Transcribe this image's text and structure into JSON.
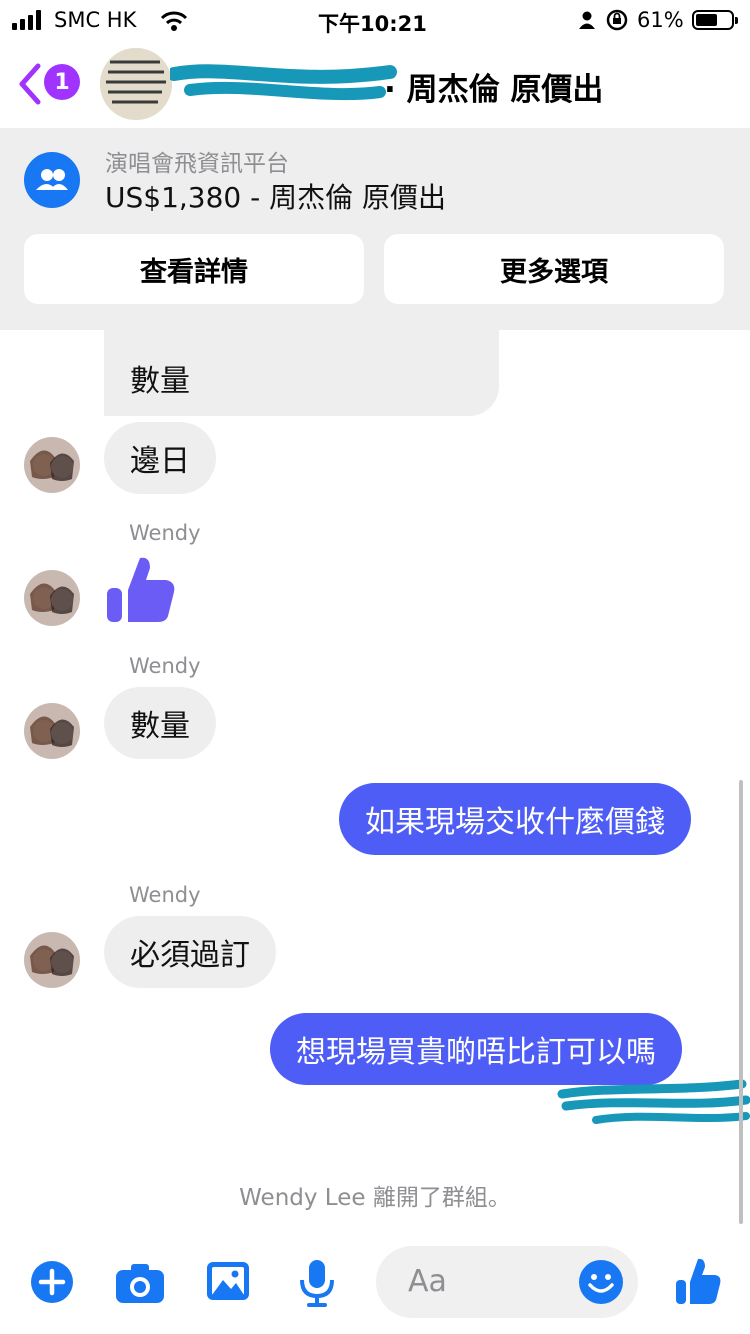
{
  "status_bar": {
    "carrier": "SMC HK",
    "time": "下午10:21",
    "battery_percent": "61%",
    "battery_level": 0.61
  },
  "header": {
    "back_badge_count": "1",
    "title": "· 周杰倫 原價出",
    "accent_color": "#a033ff"
  },
  "listing": {
    "group_name": "演唱會飛資訊平台",
    "listing_text": "US$1,380 - 周杰倫 原價出",
    "view_details_label": "查看詳情",
    "more_options_label": "更多選項"
  },
  "messages": [
    {
      "from": "other",
      "text": "數量"
    },
    {
      "from": "other",
      "text": "邊日"
    },
    {
      "from": "other",
      "sender": "Wendy",
      "content": "thumbs-up-icon"
    },
    {
      "from": "other",
      "sender": "Wendy",
      "text": "數量"
    },
    {
      "from": "me",
      "text": "如果現場交收什麼價錢"
    },
    {
      "from": "other",
      "sender": "Wendy",
      "text": "必須過訂"
    },
    {
      "from": "me",
      "text": "想現場買貴啲唔比訂可以嗎"
    }
  ],
  "system_message": "Wendy Lee 離開了群組。",
  "composer": {
    "placeholder": "Aa",
    "icons": [
      "add-icon",
      "camera-icon",
      "gallery-icon",
      "microphone-icon",
      "emoji-icon",
      "thumbs-up-icon"
    ]
  },
  "colors": {
    "my_bubble": "#4e5df5",
    "their_bubble": "#eeeeee",
    "messenger_blue": "#1877f2",
    "reaction_purple": "#6b5cf6",
    "redaction_teal": "#1798b8"
  }
}
